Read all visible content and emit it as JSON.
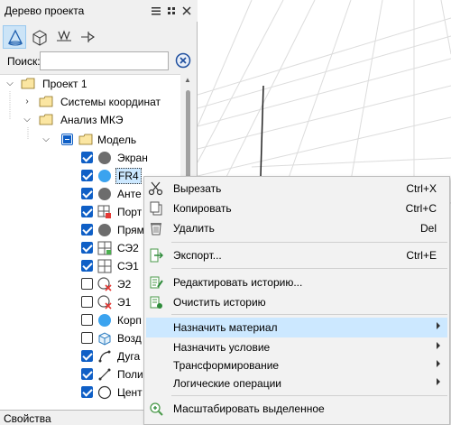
{
  "panel": {
    "title": "Дерево проекта",
    "search_label": "Поиск:",
    "search_value": "",
    "props_title": "Свойства"
  },
  "tree": {
    "project": "Проект 1",
    "coords": "Системы координат",
    "analysis": "Анализ МКЭ",
    "model": "Модель",
    "items": [
      {
        "label": "Экран",
        "checked": true
      },
      {
        "label": "FR4",
        "checked": true,
        "selected": true
      },
      {
        "label": "Анте",
        "checked": true
      },
      {
        "label": "Порт",
        "checked": true
      },
      {
        "label": "Прям",
        "checked": true
      },
      {
        "label": "СЭ2",
        "checked": true
      },
      {
        "label": "СЭ1",
        "checked": true
      },
      {
        "label": "Э2",
        "checked": false
      },
      {
        "label": "Э1",
        "checked": false
      },
      {
        "label": "Корп",
        "checked": false
      },
      {
        "label": "Возд",
        "checked": false
      },
      {
        "label": "Дуга",
        "checked": true
      },
      {
        "label": "Поли",
        "checked": true
      },
      {
        "label": "Цент",
        "checked": true
      }
    ]
  },
  "menu": {
    "cut": "Вырезать",
    "cut_sc": "Ctrl+X",
    "copy": "Копировать",
    "copy_sc": "Ctrl+C",
    "delete": "Удалить",
    "delete_sc": "Del",
    "export": "Экспорт...",
    "export_sc": "Ctrl+E",
    "edit_history": "Редактировать историю...",
    "clear_history": "Очистить историю",
    "assign_material": "Назначить материал",
    "assign_condition": "Назначить условие",
    "transform": "Трансформирование",
    "logic_ops": "Логические операции",
    "zoom_selected": "Масштабировать выделенное"
  },
  "colors": {
    "accent": "#0f5fc6",
    "highlight": "#cce8ff",
    "fr4_blue": "#3ba3ef",
    "gray_body": "#6d6d6d"
  }
}
